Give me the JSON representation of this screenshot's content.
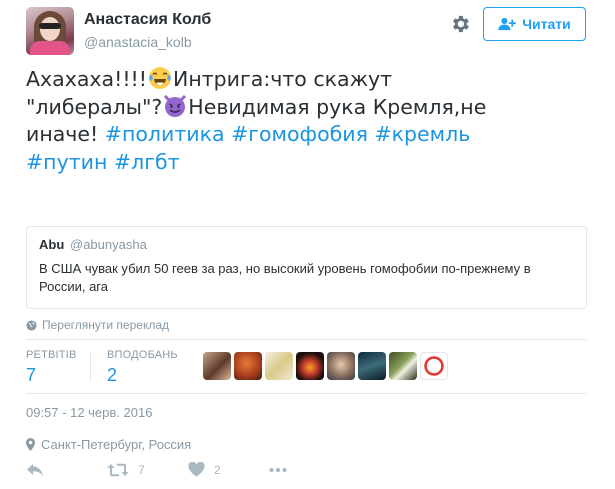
{
  "author": {
    "display_name": "Анастасия Колб",
    "handle": "@anastacia_kolb"
  },
  "follow_button": {
    "label": "Читати",
    "icon": "add-user-icon"
  },
  "settings_icon": "gear-icon",
  "tweet": {
    "line1_a": "Ахахаха!!!!",
    "emoji_1": "face-with-tears-of-joy",
    "line1_b": "Интрига:что скажут",
    "line2_a": "\"либералы\"?",
    "emoji_2": "smiling-imp",
    "line2_b": "Невидимая рука Кремля,не",
    "line3_a": "иначе!",
    "hashtags": [
      "#политика",
      "#гомофобия",
      "#кремль",
      "#путин",
      "#лгбт"
    ]
  },
  "quoted_tweet": {
    "name": "Abu",
    "handle": "@abunyasha",
    "text": "В США чувак убил 50 геев за раз, но высокий уровень гомофобии по-прежнему в России, ага"
  },
  "translate_link": "Переглянути переклад",
  "stats": {
    "retweets_label": "РЕТВІТІВ",
    "retweets_value": "7",
    "likes_label": "ВПОДОБАНЬ",
    "likes_value": "2"
  },
  "likers_count": 8,
  "timestamp": "09:57 - 12 черв. 2016",
  "location": "Санкт-Петербург, Россия",
  "actions": {
    "reply_icon": "reply-icon",
    "retweet_icon": "retweet-icon",
    "retweet_count": "7",
    "like_icon": "heart-icon",
    "like_count": "2",
    "more_icon": "more-dots-icon"
  },
  "colors": {
    "accent": "#1da1f2",
    "hashtag": "#1b95e0",
    "text": "#292f33",
    "muted": "#8899a6",
    "border": "#e1e8ed"
  }
}
